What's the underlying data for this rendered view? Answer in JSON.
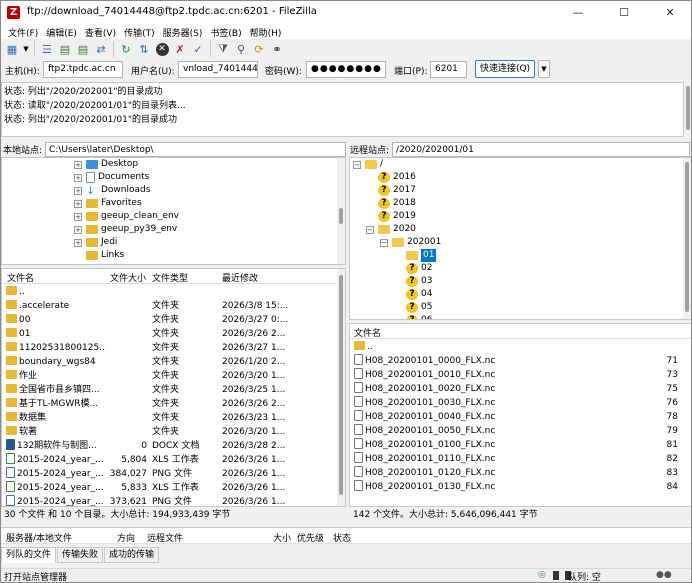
{
  "window": {
    "title": "ftp://download_74014448@ftp2.tpdc.ac.cn:6201 - FileZilla",
    "minimize": "—",
    "maximize": "☐",
    "close": "✕"
  },
  "menu": [
    "文件(F)",
    "编辑(E)",
    "查看(V)",
    "传输(T)",
    "服务器(S)",
    "书签(B)",
    "帮助(H)"
  ],
  "quickconnect": {
    "host_label": "主机(H):",
    "host": "ftp2.tpdc.ac.cn",
    "user_label": "用户名(U):",
    "user": "vnload_74014448",
    "pass_label": "密码(W):",
    "pass": "●●●●●●●●",
    "port_label": "端口(P):",
    "port": "6201",
    "connect_label": "快速连接(Q)"
  },
  "log": [
    "状态:  列出\"/2020/202001\"的目录成功",
    "状态:  读取\"/2020/202001/01\"的目录列表...",
    "状态:  列出\"/2020/202001/01\"的目录成功"
  ],
  "local": {
    "site_label": "本地站点:",
    "path": "C:\\Users\\later\\Desktop\\",
    "tree": [
      "Desktop",
      "Documents",
      "Downloads",
      "Favorites",
      "geeup_clean_env",
      "geeup_py39_env",
      "Jedi",
      "Links"
    ],
    "headers": {
      "name": "文件名",
      "size": "文件大小",
      "type": "文件类型",
      "modified": "最近修改"
    },
    "files": [
      {
        "name": "..",
        "size": "",
        "type": "",
        "modified": "",
        "icon": "folder"
      },
      {
        "name": ".accelerate",
        "size": "",
        "type": "文件夹",
        "modified": "2026/3/8 15:...",
        "icon": "folder"
      },
      {
        "name": "00",
        "size": "",
        "type": "文件夹",
        "modified": "2026/3/27 0:...",
        "icon": "folder"
      },
      {
        "name": "01",
        "size": "",
        "type": "文件夹",
        "modified": "2026/3/26 2...",
        "icon": "folder"
      },
      {
        "name": "11202531800125...",
        "size": "",
        "type": "文件夹",
        "modified": "2026/3/27 1...",
        "icon": "folder"
      },
      {
        "name": "boundary_wgs84",
        "size": "",
        "type": "文件夹",
        "modified": "2026/1/20 2...",
        "icon": "folder"
      },
      {
        "name": "作业",
        "size": "",
        "type": "文件夹",
        "modified": "2026/3/20 1...",
        "icon": "folder"
      },
      {
        "name": "全国省市县乡镇四...",
        "size": "",
        "type": "文件夹",
        "modified": "2026/3/25 1...",
        "icon": "folder"
      },
      {
        "name": "基于TL-MGWR模...",
        "size": "",
        "type": "文件夹",
        "modified": "2026/3/26 2...",
        "icon": "folder"
      },
      {
        "name": "数据集",
        "size": "",
        "type": "文件夹",
        "modified": "2026/3/23 1...",
        "icon": "folder"
      },
      {
        "name": "软著",
        "size": "",
        "type": "文件夹",
        "modified": "2026/3/20 1...",
        "icon": "folder"
      },
      {
        "name": "132期软件与制图...",
        "size": "0",
        "type": "DOCX 文档",
        "modified": "2026/3/28 2...",
        "icon": "doc"
      },
      {
        "name": "2015-2024_year_...",
        "size": "5,804",
        "type": "XLS 工作表",
        "modified": "2026/3/26 1...",
        "icon": "xls"
      },
      {
        "name": "2015-2024_year_...",
        "size": "384,027",
        "type": "PNG 文件",
        "modified": "2026/3/26 1...",
        "icon": "png"
      },
      {
        "name": "2015-2024_year_...",
        "size": "5,833",
        "type": "XLS 工作表",
        "modified": "2026/3/26 1...",
        "icon": "xls"
      },
      {
        "name": "2015-2024_year_...",
        "size": "373,621",
        "type": "PNG 文件",
        "modified": "2026/3/26 1...",
        "icon": "png"
      }
    ],
    "status": "30 个文件 和 10 个目录。大小总计: 194,933,439 字节"
  },
  "remote": {
    "site_label": "远程站点:",
    "path": "/2020/202001/01",
    "tree": {
      "root": "/",
      "years": [
        "2016",
        "2017",
        "2018",
        "2019"
      ],
      "year_open": "2020",
      "month": "202001",
      "days": [
        "01",
        "02",
        "03",
        "04",
        "05",
        "06"
      ]
    },
    "headers": {
      "name": "文件名"
    },
    "files": [
      {
        "name": "..",
        "size": ""
      },
      {
        "name": "H08_20200101_0000_FLX.nc",
        "size": "71"
      },
      {
        "name": "H08_20200101_0010_FLX.nc",
        "size": "73"
      },
      {
        "name": "H08_20200101_0020_FLX.nc",
        "size": "75"
      },
      {
        "name": "H08_20200101_0030_FLX.nc",
        "size": "76"
      },
      {
        "name": "H08_20200101_0040_FLX.nc",
        "size": "78"
      },
      {
        "name": "H08_20200101_0050_FLX.nc",
        "size": "79"
      },
      {
        "name": "H08_20200101_0100_FLX.nc",
        "size": "81"
      },
      {
        "name": "H08_20200101_0110_FLX.nc",
        "size": "82"
      },
      {
        "name": "H08_20200101_0120_FLX.nc",
        "size": "83"
      },
      {
        "name": "H08_20200101_0130_FLX.nc",
        "size": "84"
      }
    ],
    "status": "142 个文件。大小总计: 5,646,096,441 字节"
  },
  "queue": {
    "cols": [
      "服务器/本地文件",
      "方向",
      "远程文件",
      "大小",
      "优先级",
      "状态"
    ],
    "tabs": [
      "列队的文件",
      "传输失败",
      "成功的传输"
    ]
  },
  "statusbar": {
    "left": "打开站点管理器",
    "queue": "队列: 空"
  }
}
